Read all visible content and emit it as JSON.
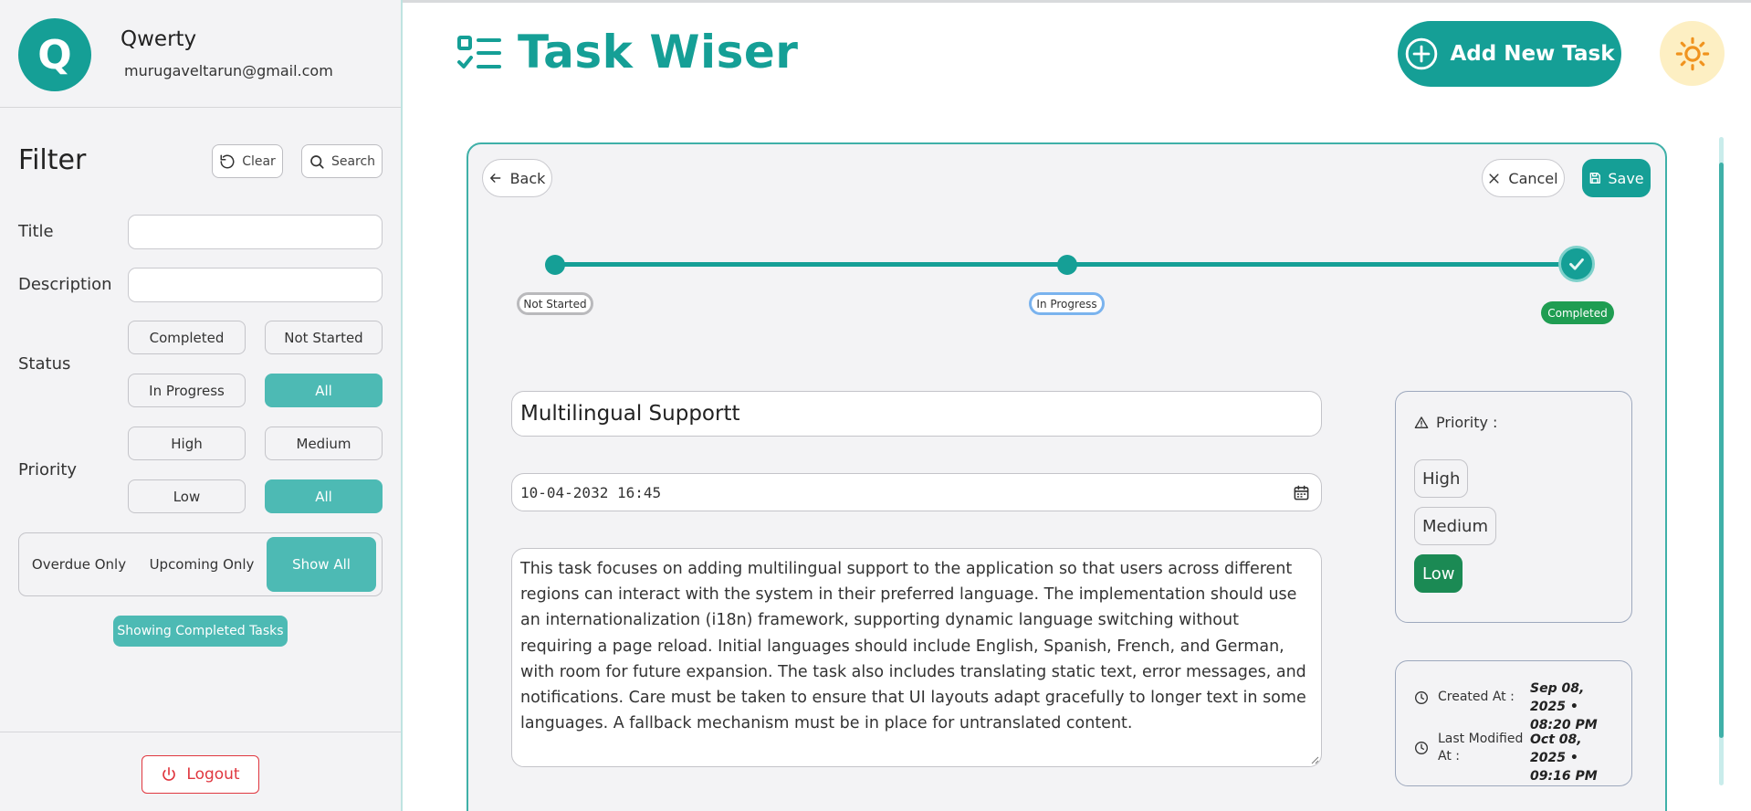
{
  "user": {
    "initial": "Q",
    "name": "Qwerty",
    "email": "murugaveltarun@gmail.com"
  },
  "filter": {
    "title": "Filter",
    "clear_label": "Clear",
    "search_label": "Search",
    "title_label": "Title",
    "title_value": "",
    "description_label": "Description",
    "description_value": "",
    "status_label": "Status",
    "status_options": [
      "Completed",
      "Not Started",
      "In Progress",
      "All"
    ],
    "status_selected": "All",
    "priority_label": "Priority",
    "priority_options": [
      "High",
      "Medium",
      "Low",
      "All"
    ],
    "priority_selected": "All",
    "due_options": [
      "Overdue Only",
      "Upcoming Only",
      "Show All"
    ],
    "due_selected": "Show All",
    "showing_label": "Showing Completed Tasks",
    "logout_label": "Logout"
  },
  "header": {
    "app_title": "Task Wiser",
    "add_task_label": "Add New Task",
    "theme_icon": "sun-icon"
  },
  "task": {
    "back_label": "Back",
    "cancel_label": "Cancel",
    "save_label": "Save",
    "steps": [
      "Not Started",
      "In Progress",
      "Completed"
    ],
    "current_step": "Completed",
    "title": "Multilingual Supportt",
    "due": "10-04-2032 16:45",
    "description": "This task focuses on adding multilingual support to the application so that users across different regions can interact with the system in their preferred language. The implementation should use an internationalization (i18n) framework, supporting dynamic language switching without requiring a page reload. Initial languages should include English, Spanish, French, and German, with room for future expansion. The task also includes translating static text, error messages, and notifications. Care must be taken to ensure that UI layouts adapt gracefully to longer text in some languages. A fallback mechanism must be in place for untranslated content.",
    "priority_label": "Priority :",
    "priority_options": [
      "High",
      "Medium",
      "Low"
    ],
    "priority_selected": "Low",
    "created_label": "Created At :",
    "created_value": "Sep 08, 2025 • 08:20 PM",
    "modified_label": "Last Modified At :",
    "modified_value": "Oct 08, 2025 • 09:16 PM"
  },
  "colors": {
    "accent": "#159f96",
    "accent_light": "#4dbab4",
    "success": "#1f9d52",
    "danger": "#e0373f"
  }
}
